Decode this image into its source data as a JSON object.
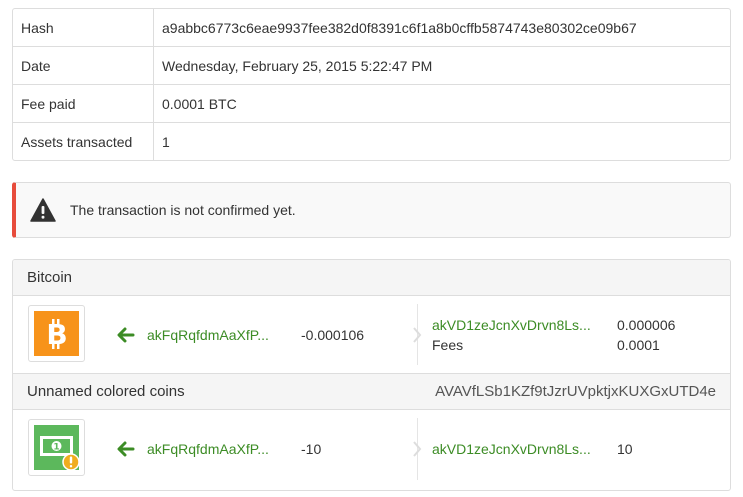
{
  "info": {
    "rows": [
      {
        "key": "Hash",
        "value": "a9abbc6773c6eae9937fee382d0f8391c6f1a8b0cffb5874743e80302ce09b67"
      },
      {
        "key": "Date",
        "value": "Wednesday, February 25, 2015 5:22:47 PM"
      },
      {
        "key": "Fee paid",
        "value": "0.0001 BTC"
      },
      {
        "key": "Assets transacted",
        "value": "1"
      }
    ]
  },
  "alert": {
    "icon": "warning-icon",
    "text": "The transaction is not confirmed yet.",
    "accent_color": "#e74c3c"
  },
  "assets": [
    {
      "name": "Bitcoin",
      "asset_id": "",
      "icon": "bitcoin-icon",
      "color": "#f7931a",
      "input": {
        "address": "akFqRqfdmAaXfP...",
        "amount": "-0.000106"
      },
      "outputs": [
        {
          "address": "akVD1zeJcnXvDrvn8Ls...",
          "amount": "0.000006"
        },
        {
          "label": "Fees",
          "amount": "0.0001"
        }
      ]
    },
    {
      "name": "Unnamed colored coins",
      "asset_id": "AVAVfLSb1KZf9tJzrUVpktjxKUXGxUTD4e",
      "icon": "banknote-warning-icon",
      "color": "#5cb85c",
      "input": {
        "address": "akFqRqfdmAaXfP...",
        "amount": "-10"
      },
      "outputs": [
        {
          "address": "akVD1zeJcnXvDrvn8Ls...",
          "amount": "10"
        }
      ]
    }
  ],
  "colors": {
    "link_green": "#3c8c25",
    "arrow_green": "#3c8c25",
    "border": "#dddddd"
  }
}
